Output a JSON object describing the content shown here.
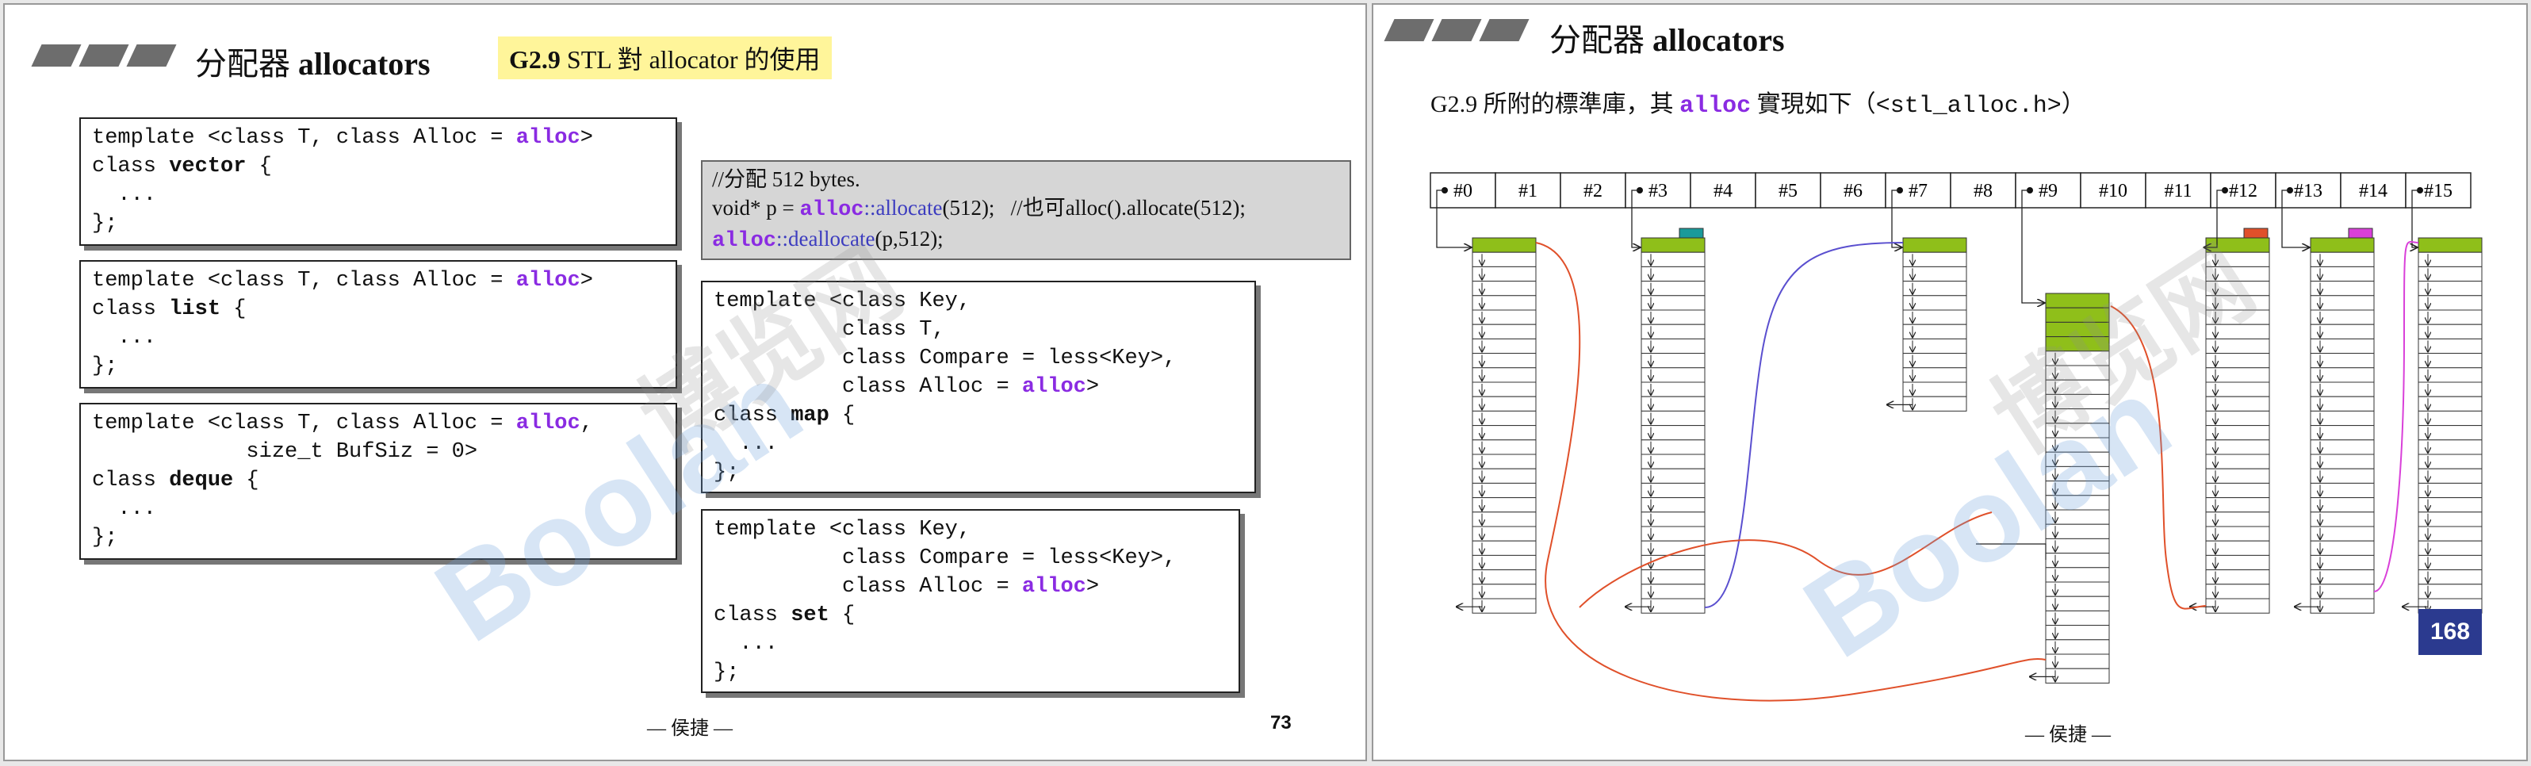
{
  "left_slide": {
    "title_zh": "分配器",
    "title_en": "allocators",
    "tag_version": "G2.9",
    "tag_text": " STL 對 allocator 的使用",
    "vector_box": {
      "l1a": "template <class T, class Alloc = ",
      "l1b": "alloc",
      "l1c": ">",
      "l2a": "class ",
      "l2b": "vector",
      "l2c": " {",
      "l3": "  ...",
      "l4": "};"
    },
    "list_box": {
      "l1a": "template <class T, class Alloc = ",
      "l1b": "alloc",
      "l1c": ">",
      "l2a": "class ",
      "l2b": "list",
      "l2c": " {",
      "l3": "  ...",
      "l4": "};"
    },
    "deque_box": {
      "l1a": "template <class T, class Alloc = ",
      "l1b": "alloc",
      "l1c": ",",
      "l2": "            size_t BufSiz = 0>",
      "l3a": "class ",
      "l3b": "deque",
      "l3c": " {",
      "l4": "  ...",
      "l5": "};"
    },
    "note_box": {
      "l1": "//分配 512 bytes.",
      "l2a": "void* p = ",
      "l2b": "alloc",
      "l2c": "::allocate",
      "l2d": "(512);   //也可alloc().allocate(512);",
      "l3a": "alloc",
      "l3b": "::deallocate",
      "l3c": "(p,512);"
    },
    "map_box": {
      "l1": "template <class Key,",
      "l2": "          class T,",
      "l3": "          class Compare = less<Key>,",
      "l4a": "          class Alloc = ",
      "l4b": "alloc",
      "l4c": ">",
      "l5a": "class ",
      "l5b": "map",
      "l5c": " {",
      "l6": "  ...",
      "l7": "};"
    },
    "set_box": {
      "l1": "template <class Key,",
      "l2": "          class Compare = less<Key>,",
      "l3a": "          class Alloc = ",
      "l3b": "alloc",
      "l3c": ">",
      "l4a": "class ",
      "l4b": "set",
      "l4c": " {",
      "l5": "  ...",
      "l6": "};"
    },
    "footer": "— 侯捷 —",
    "page_number": "73",
    "watermark": "Boolan",
    "watermark_cn": "博览网"
  },
  "right_slide": {
    "title_zh": "分配器",
    "title_en": "allocators",
    "subtitle_a": "G2.9 所附的標準庫，其 ",
    "subtitle_b": "alloc",
    "subtitle_c": " 實現如下（",
    "subtitle_d": "<stl_alloc.h>",
    "subtitle_e": "）",
    "free_list_labels": [
      "#0",
      "#1",
      "#2",
      "#3",
      "#4",
      "#5",
      "#6",
      "#7",
      "#8",
      "#9",
      "#10",
      "#11",
      "#12",
      "#13",
      "#14",
      "#15"
    ],
    "badge": "168",
    "footer": "— 侯捷 —",
    "watermark": "Boolan",
    "watermark_cn": "博览网",
    "colors": {
      "green_block": "#8fbf1a",
      "red_curve": "#e0502a",
      "purple_curve": "#5a4fcf",
      "magenta_curve": "#d940d9",
      "teal_cap": "#1a9a9a",
      "red_cap": "#e0502a",
      "magenta_cap": "#d940d9",
      "badge": "#2b3a8f"
    }
  }
}
